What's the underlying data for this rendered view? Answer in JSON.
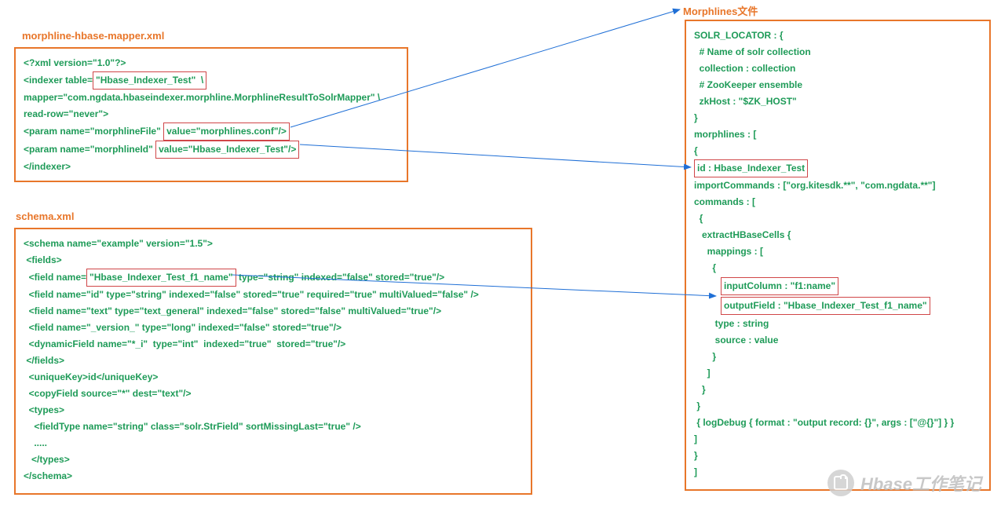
{
  "titles": {
    "mapper": "morphline-hbase-mapper.xml",
    "schema": "schema.xml",
    "morphlines": "Morphlines文件"
  },
  "mapper": {
    "l1": "<?xml version=\"1.0\"?>",
    "l2a": "<indexer table=",
    "l2b": "\"Hbase_Indexer_Test\"  \\",
    "l3": "mapper=\"com.ngdata.hbaseindexer.morphline.MorphlineResultToSolrMapper\" \\",
    "l4": "read-row=\"never\">",
    "l5a": "<param name=\"morphlineFile\" ",
    "l5b": "value=\"morphlines.conf\"/>",
    "l6a": "<param name=\"morphlineId\" ",
    "l6b": "value=\"Hbase_Indexer_Test\"/>",
    "l7": "</indexer>"
  },
  "schema": {
    "l1": "<schema name=\"example\" version=\"1.5\">",
    "l2": " <fields>",
    "l3a": "  <field name=",
    "l3b": "\"Hbase_Indexer_Test_f1_name\"",
    "l3c": " type=\"string\" indexed=\"false\" stored=\"true\"/>",
    "l4": "  <field name=\"id\" type=\"string\" indexed=\"false\" stored=\"true\" required=\"true\" multiValued=\"false\" />",
    "l5": "  <field name=\"text\" type=\"text_general\" indexed=\"false\" stored=\"false\" multiValued=\"true\"/>",
    "l6": "  <field name=\"_version_\" type=\"long\" indexed=\"false\" stored=\"true\"/>",
    "l7": "  <dynamicField name=\"*_i\"  type=\"int\"  indexed=\"true\"  stored=\"true\"/>",
    "l8": " </fields>",
    "l9": "  <uniqueKey>id</uniqueKey>",
    "l10": "  <copyField source=\"*\" dest=\"text\"/>",
    "l11": "  <types>",
    "l12": "    <fieldType name=\"string\" class=\"solr.StrField\" sortMissingLast=\"true\" />",
    "l13": "    .....",
    "l14": "   </types>",
    "l15": "</schema>"
  },
  "morph": {
    "l1": "SOLR_LOCATOR : {",
    "l2": "  # Name of solr collection",
    "l3": "  collection : collection",
    "l4": "  # ZooKeeper ensemble",
    "l5": "  zkHost : \"$ZK_HOST\"",
    "l6": "}",
    "l7": "morphlines : [",
    "l8": "{",
    "l9": "id : Hbase_Indexer_Test",
    "l10": "importCommands : [\"org.kitesdk.**\", \"com.ngdata.**\"]",
    "l11": "commands : [",
    "l12": "  {",
    "l13": "   extractHBaseCells {",
    "l14": "     mappings : [",
    "l15": "       {",
    "l16a": "inputColumn : \"f1:name\"",
    "l16b": "outputField : \"Hbase_Indexer_Test_f1_name\"",
    "l17": "        type : string",
    "l18": "        source : value",
    "l19": "       }",
    "l20": "     ]",
    "l21": "   }",
    "l22": " }",
    "l23": " { logDebug { format : \"output record: {}\", args : [\"@{}\"] } }",
    "l24": "]",
    "l25": "}",
    "l26": "]"
  },
  "watermark": "Hbase工作笔记"
}
